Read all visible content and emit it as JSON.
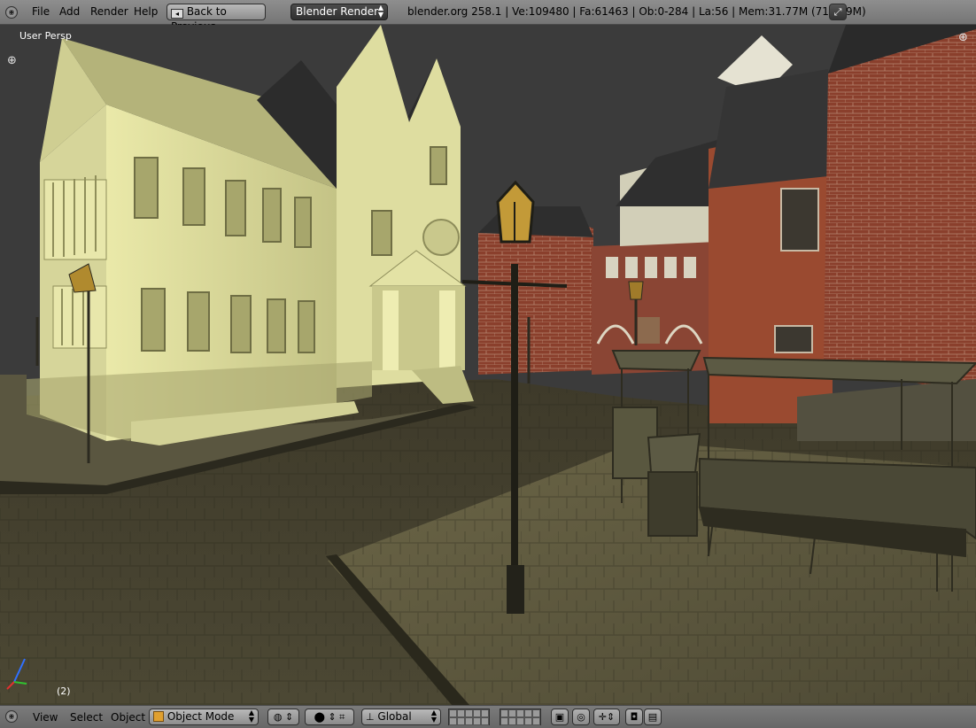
{
  "header": {
    "menu": [
      "File",
      "Add",
      "Render",
      "Help"
    ],
    "back_button": "Back to Previous",
    "render_engine": "Blender Render",
    "stats": "blender.org 258.1 | Ve:109480 | Fa:61463 | Ob:0-284 | La:56 | Mem:31.77M (718.49M)"
  },
  "viewport": {
    "view_name": "User Persp",
    "frame": "(2)"
  },
  "footer": {
    "menu": [
      "View",
      "Select",
      "Object"
    ],
    "mode": "Object Mode",
    "orientation": "Global"
  },
  "icons": {
    "editor_type": "editor-type-icon",
    "maximize": "maximize-icon",
    "object_mode": "object-mode-icon",
    "viewport_shading": "shading-icon",
    "pivot": "pivot-icon",
    "manipulator": "manipulator-icon",
    "orientation": "orientation-icon",
    "proportional": "proportional-edit-icon",
    "snap": "snap-icon",
    "render": "render-camera-icon",
    "animation": "clapper-icon"
  }
}
